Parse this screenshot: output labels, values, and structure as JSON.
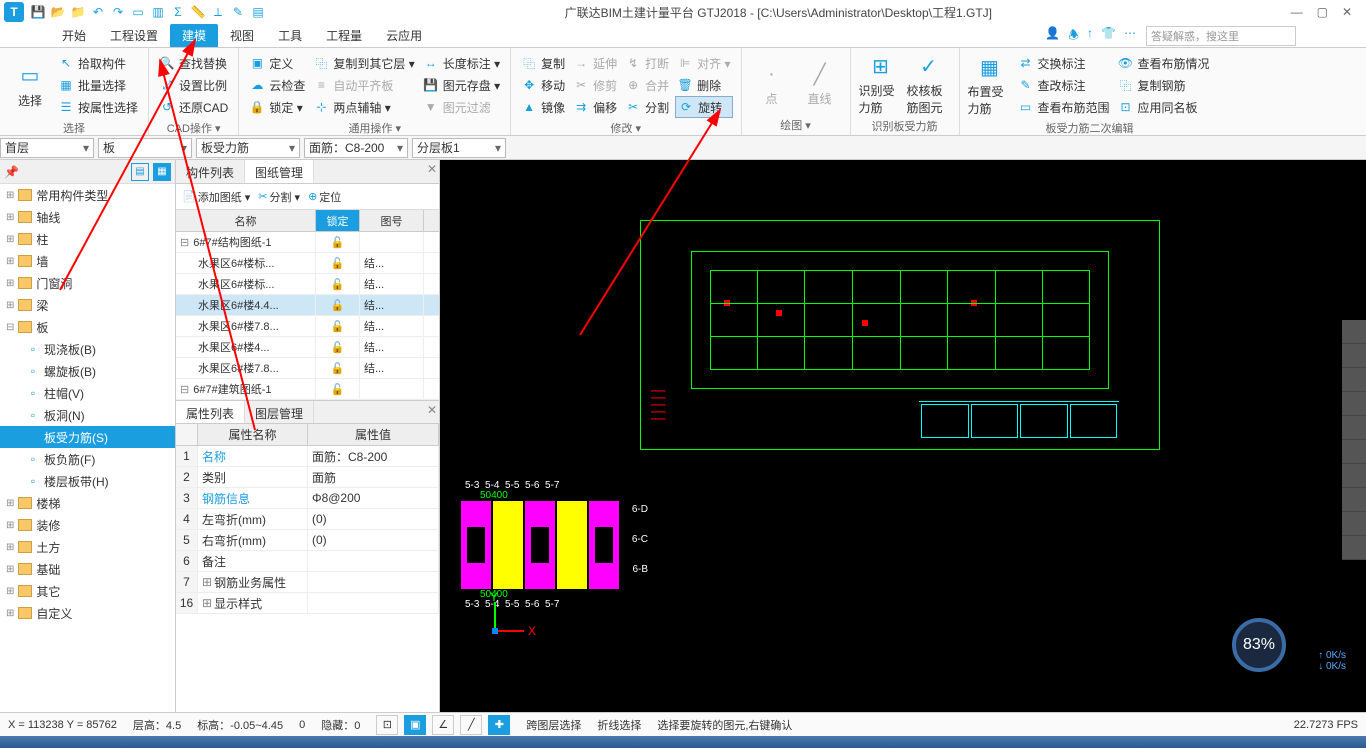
{
  "app": {
    "title": "广联达BIM土建计量平台 GTJ2018 - [C:\\Users\\Administrator\\Desktop\\工程1.GTJ]"
  },
  "searchbox": {
    "placeholder": "答疑解惑，搜这里"
  },
  "menu": {
    "items": [
      "开始",
      "工程设置",
      "建模",
      "视图",
      "工具",
      "工程量",
      "云应用"
    ],
    "active": 2
  },
  "ribbon": {
    "select": {
      "label": "选择",
      "big": "选择",
      "items": [
        "拾取构件",
        "批量选择",
        "按属性选择"
      ]
    },
    "cad": {
      "label": "CAD操作 ▾",
      "items": [
        "查找替换",
        "设置比例",
        "还原CAD",
        "定义",
        "云检查",
        "锁定 ▾",
        "复制到其它层 ▾",
        "自动平齐板",
        "两点辅轴 ▾"
      ],
      "items2": [
        "长度标注 ▾",
        "图元存盘 ▾",
        "图元过滤"
      ]
    },
    "common": {
      "label": "通用操作 ▾"
    },
    "modify": {
      "label": "修改 ▾",
      "items": [
        "复制",
        "移动",
        "镜像",
        "延伸",
        "修剪",
        "偏移",
        "打断",
        "合并",
        "分割",
        "对齐 ▾",
        "删除",
        "旋转"
      ]
    },
    "draw": {
      "label": "绘图 ▾",
      "point": "点",
      "line": "直线"
    },
    "recognize": {
      "label": "识别板受力筋",
      "items": [
        "识别受力筋",
        "校核板筋图元"
      ]
    },
    "slab": {
      "label": "板受力筋二次编辑",
      "layout": "布置受力筋",
      "items": [
        "交换标注",
        "查改标注",
        "查看布筋范围",
        "查看布筋情况",
        "复制钢筋",
        "应用同名板"
      ]
    }
  },
  "dropdowns": {
    "floor": "首层",
    "category": "板",
    "type": "板受力筋",
    "component": "面筋：C8-200",
    "layer": "分层板1"
  },
  "tree": {
    "items": [
      {
        "label": "常用构件类型",
        "level": 1
      },
      {
        "label": "轴线",
        "level": 1
      },
      {
        "label": "柱",
        "level": 1
      },
      {
        "label": "墙",
        "level": 1
      },
      {
        "label": "门窗洞",
        "level": 1
      },
      {
        "label": "梁",
        "level": 1
      },
      {
        "label": "板",
        "level": 1,
        "expanded": true
      },
      {
        "label": "现浇板(B)",
        "level": 2,
        "icon": "slab"
      },
      {
        "label": "螺旋板(B)",
        "level": 2,
        "icon": "spiral"
      },
      {
        "label": "柱帽(V)",
        "level": 2,
        "icon": "cap"
      },
      {
        "label": "板洞(N)",
        "level": 2,
        "icon": "hole"
      },
      {
        "label": "板受力筋(S)",
        "level": 2,
        "icon": "rebar",
        "selected": true
      },
      {
        "label": "板负筋(F)",
        "level": 2,
        "icon": "rebar2"
      },
      {
        "label": "楼层板带(H)",
        "level": 2,
        "icon": "strip"
      },
      {
        "label": "楼梯",
        "level": 1
      },
      {
        "label": "装修",
        "level": 1
      },
      {
        "label": "土方",
        "level": 1
      },
      {
        "label": "基础",
        "level": 1
      },
      {
        "label": "其它",
        "level": 1
      },
      {
        "label": "自定义",
        "level": 1
      }
    ]
  },
  "midpane": {
    "tabs": [
      "构件列表",
      "图纸管理"
    ],
    "activeTab": 1,
    "toolbar": [
      "添加图纸 ▾",
      "分割 ▾",
      "定位"
    ],
    "headers": {
      "name": "名称",
      "lock": "锁定",
      "number": "图号"
    },
    "rows": [
      {
        "name": "6#7#结构图纸-1",
        "lock": true,
        "number": "",
        "group": true
      },
      {
        "name": "水果区6#楼标...",
        "lock": true,
        "number": "结..."
      },
      {
        "name": "水果区6#楼标...",
        "lock": true,
        "number": "结..."
      },
      {
        "name": "水果区6#楼4.4...",
        "lock": true,
        "number": "结...",
        "selected": true
      },
      {
        "name": "水果区6#楼7.8...",
        "lock": true,
        "number": "结..."
      },
      {
        "name": "水果区6#楼4...",
        "lock": true,
        "number": "结..."
      },
      {
        "name": "水果区6#楼7.8...",
        "lock": true,
        "number": "结..."
      },
      {
        "name": "6#7#建筑图纸-1",
        "lock": true,
        "number": "",
        "group": true
      }
    ]
  },
  "props": {
    "tabs": [
      "属性列表",
      "图层管理"
    ],
    "activeTab": 0,
    "headers": {
      "name": "属性名称",
      "value": "属性值"
    },
    "rows": [
      {
        "n": "1",
        "name": "名称",
        "value": "面筋：C8-200",
        "link": true
      },
      {
        "n": "2",
        "name": "类别",
        "value": "面筋"
      },
      {
        "n": "3",
        "name": "钢筋信息",
        "value": "Φ8@200",
        "link": true
      },
      {
        "n": "4",
        "name": "左弯折(mm)",
        "value": "(0)"
      },
      {
        "n": "5",
        "name": "右弯折(mm)",
        "value": "(0)"
      },
      {
        "n": "6",
        "name": "备注",
        "value": ""
      },
      {
        "n": "7",
        "name": "钢筋业务属性",
        "value": "",
        "expand": true
      },
      {
        "n": "16",
        "name": "显示样式",
        "value": "",
        "expand": true
      }
    ]
  },
  "statusbar": {
    "coords": "X = 113238 Y = 85762",
    "floorHeight": "层高：4.5",
    "elevation": "标高：-0.05~4.45",
    "zero": "0",
    "hidden": "隐藏：0",
    "crossFloor": "跨图层选择",
    "foldSelect": "折线选择",
    "hint": "选择要旋转的图元,右键确认",
    "fps": "22.7273 FPS"
  },
  "perf": {
    "percent": "83%",
    "up": "0K/s",
    "down": "0K/s"
  },
  "viewport": {
    "gridLabels": [
      "5-3",
      "5-4",
      "5-5",
      "5-6",
      "5-7"
    ],
    "gridLabelsY": [
      "6-D",
      "6-C",
      "6-B"
    ],
    "dim": "50400"
  }
}
